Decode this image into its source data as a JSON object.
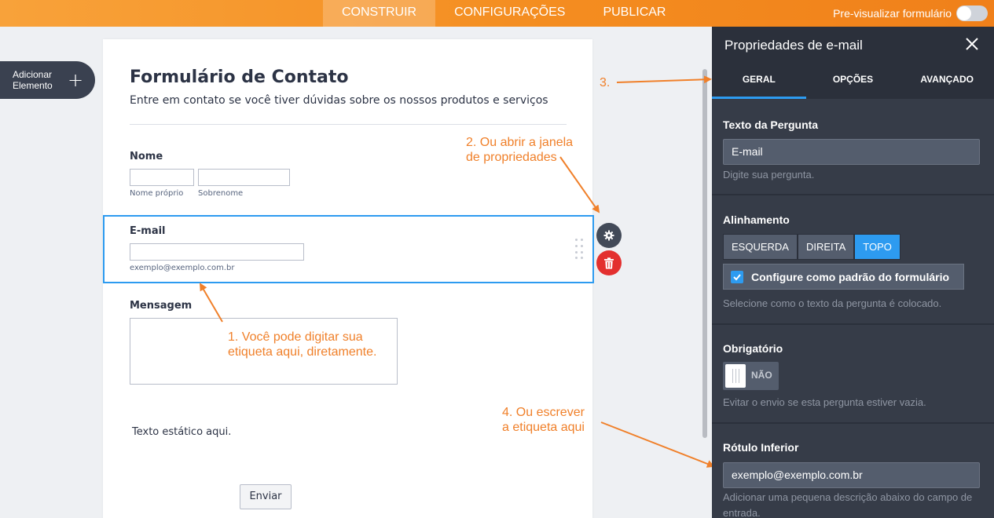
{
  "topbar": {
    "tabs": [
      {
        "label": "CONSTRUIR",
        "active": true
      },
      {
        "label": "CONFIGURAÇÕES",
        "active": false
      },
      {
        "label": "PUBLICAR",
        "active": false
      }
    ],
    "preview_label": "Pre-visualizar formulário",
    "preview_on": false
  },
  "sidebar": {
    "add_element_line1": "Adicionar",
    "add_element_line2": "Elemento"
  },
  "form": {
    "title": "Formulário de Contato",
    "subtitle": "Entre em contato se você tiver dúvidas sobre os nossos produtos e serviços",
    "name": {
      "label": "Nome",
      "first_sublabel": "Nome próprio",
      "last_sublabel": "Sobrenome"
    },
    "email": {
      "label": "E-mail",
      "sublabel": "exemplo@exemplo.com.br"
    },
    "message": {
      "label": "Mensagem"
    },
    "static_text": "Texto estático aqui.",
    "submit_label": "Enviar"
  },
  "annotations": {
    "step1_line1": "1. Você pode digitar sua",
    "step1_line2": "etiqueta aqui, diretamente.",
    "step2_line1": "2. Ou abrir a janela",
    "step2_line2": "de propriedades",
    "step3": "3.",
    "step4_line1": "4. Ou escrever",
    "step4_line2": "a etiqueta aqui",
    "color": "#f0802a"
  },
  "panel": {
    "title": "Propriedades de e-mail",
    "tabs": [
      {
        "label": "GERAL",
        "active": true
      },
      {
        "label": "OPÇÕES",
        "active": false
      },
      {
        "label": "AVANÇADO",
        "active": false
      }
    ],
    "question_text": {
      "label": "Texto da Pergunta",
      "value": "E-mail",
      "help": "Digite sua pergunta."
    },
    "alignment": {
      "label": "Alinhamento",
      "options": [
        "ESQUERDA",
        "DIREITA",
        "TOPO"
      ],
      "selected": "TOPO",
      "default_label": "Configure como padrão do formulário",
      "default_checked": true,
      "help": "Selecione como o texto da pergunta é colocado."
    },
    "required": {
      "label": "Obrigatório",
      "state": "NÃO",
      "help": "Evitar o envio se esta pergunta estiver vazia."
    },
    "sublabel": {
      "label": "Rótulo Inferior",
      "value": "exemplo@exemplo.com.br",
      "help": "Adicionar uma pequena descrição abaixo do campo de entrada."
    }
  },
  "colors": {
    "accent_orange": "#f48d20",
    "selection_blue": "#2d9bf0",
    "delete_red": "#e3302f",
    "panel_bg": "#363c48"
  }
}
